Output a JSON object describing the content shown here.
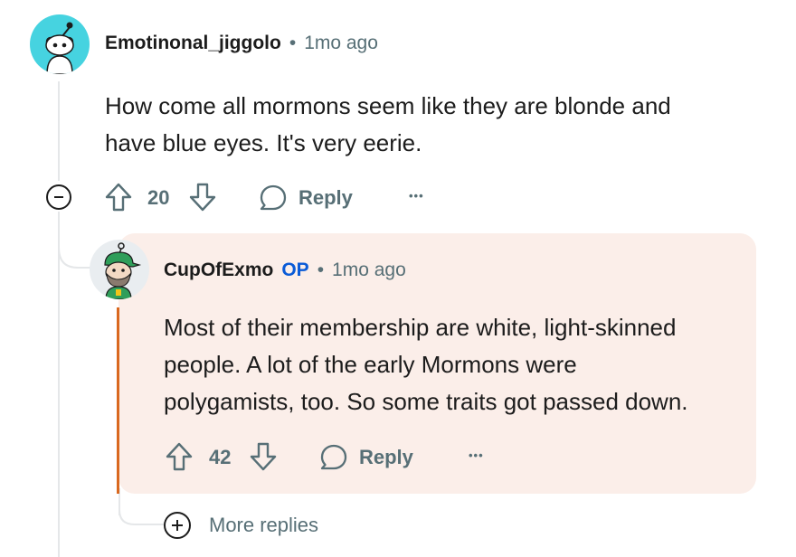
{
  "comment": {
    "username": "Emotinonal_jiggolo",
    "separator": "•",
    "time": "1mo ago",
    "body_line1": "How come all mormons seem like they are blonde and",
    "body_line2": "have blue eyes. It's very eerie.",
    "score": "20",
    "reply_label": "Reply",
    "more_label": "•••",
    "avatar_icon": "snoo-avatar-icon",
    "avatar_color": "#46d3e0"
  },
  "reply": {
    "username": "CupOfExmo",
    "op_badge": "OP",
    "separator": "•",
    "time": "1mo ago",
    "body_line1": "Most of their membership are white, light-skinned",
    "body_line2": "people. A lot of the early Mormons were",
    "body_line3": "polygamists, too. So some traits got passed down.",
    "score": "42",
    "reply_label": "Reply",
    "more_label": "•••",
    "card_color": "#fbeee9",
    "op_color": "#0a5bd7",
    "op_bar_color": "#d9681f"
  },
  "more_replies": {
    "label": "More replies"
  }
}
